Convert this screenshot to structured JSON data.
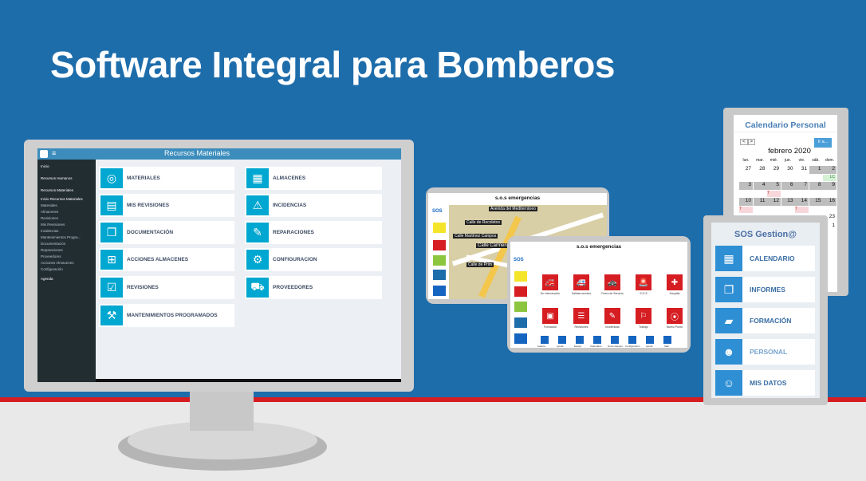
{
  "headline": "Software Integral para Bomberos",
  "monitor": {
    "app_title": "Recursos Materiales",
    "menu_icon": "≡",
    "sidebar": [
      "Inicio",
      "Recursos Humanos",
      "Recursos Materiales",
      "Inicio Recursos Materiales",
      "Materiales",
      "Almacenes",
      "Revisiones",
      "Mis Revisiones",
      "Incidencias",
      "Mantenimientos Progra...",
      "Documentación",
      "Reparaciones",
      "Proveedores",
      "Acciones Almacenes",
      "Configuración",
      "Agenda"
    ],
    "tiles": [
      {
        "label": "MATERIALES",
        "icon": "recycle-icon",
        "glyph": "◎"
      },
      {
        "label": "ALMACENES",
        "icon": "truck-icon",
        "glyph": "▦"
      },
      {
        "label": "MIS REVISIONES",
        "icon": "document-icon",
        "glyph": "▤"
      },
      {
        "label": "INCIDENCIAS",
        "icon": "warning-icon",
        "glyph": "⚠"
      },
      {
        "label": "DOCUMENTACIÓN",
        "icon": "files-icon",
        "glyph": "❐"
      },
      {
        "label": "REPARACIONES",
        "icon": "wrench-icon",
        "glyph": "✎"
      },
      {
        "label": "ACCIONES ALMACENES",
        "icon": "sitemap-icon",
        "glyph": "⊞"
      },
      {
        "label": "CONFIGURACION",
        "icon": "gear-icon",
        "glyph": "⚙"
      },
      {
        "label": "REVISIONES",
        "icon": "checklist-icon",
        "glyph": "☑"
      },
      {
        "label": "PROVEEDORES",
        "icon": "delivery-icon",
        "glyph": "⛟"
      },
      {
        "label": "MANTENIMIENTOS PROGRAMADOS",
        "icon": "car-wrench-icon",
        "glyph": "⚒"
      }
    ]
  },
  "tablet_map": {
    "title": "s.o.s emergencias",
    "sos_label": "SOS",
    "street_labels": [
      "Calle Carmen",
      "Calle de Recoletos",
      "Calle Martínez Campos",
      "Calle de Prim",
      "Avenida del Mediterráneo"
    ]
  },
  "tablet_sos": {
    "title": "s.o.s emergencias",
    "sos_label": "SOS",
    "buttons": [
      {
        "label": "En intervención",
        "glyph": "🚒"
      },
      {
        "label": "Salidas servicio",
        "glyph": "🚑"
      },
      {
        "label": "Fuera de Servicio",
        "glyph": "🚓"
      },
      {
        "label": "S.O.S",
        "glyph": "🚨"
      },
      {
        "label": "Hospital",
        "glyph": "✚"
      },
      {
        "label": "Formación",
        "glyph": "▣"
      },
      {
        "label": "Revisiones",
        "glyph": "☰"
      },
      {
        "label": "Incidencias",
        "glyph": "✎"
      },
      {
        "label": "Trabajo",
        "glyph": "⚐"
      },
      {
        "label": "Nuevo Punto",
        "glyph": "⦿"
      }
    ],
    "bottom": [
      "Galería",
      "Ayuda",
      "Equipo",
      "Calendario",
      "Nuevo Equipo",
      "Configuración",
      "Ayuda",
      "Salir"
    ]
  },
  "calendar": {
    "title": "Calendario Personal",
    "prev": "<",
    "next": ">",
    "go_btn": "Ir a...",
    "month": "febrero 2020",
    "weekdays": [
      "lun.",
      "mar.",
      "mié.",
      "jue.",
      "vie.",
      "sáb.",
      "dom."
    ],
    "rows": [
      [
        "27",
        "28",
        "29",
        "30",
        "31",
        "1",
        "2"
      ],
      [
        "",
        "",
        "",
        "",
        "",
        "",
        "LC"
      ],
      [
        "3",
        "4",
        "5",
        "6",
        "7",
        "8",
        "9"
      ],
      [
        "",
        "",
        "T",
        "",
        "",
        "",
        ""
      ],
      [
        "10",
        "11",
        "12",
        "13",
        "14",
        "15",
        "16"
      ],
      [
        "T",
        "",
        "",
        "",
        "T",
        "",
        ""
      ],
      [
        "",
        "",
        "",
        "",
        "",
        "",
        "23"
      ],
      [
        "",
        "",
        "",
        "",
        "",
        "",
        "1"
      ]
    ]
  },
  "gestion": {
    "title": "SOS Gestion@",
    "items": [
      {
        "label": "CALENDARIO",
        "glyph": "▦"
      },
      {
        "label": "INFORMES",
        "glyph": "❐"
      },
      {
        "label": "FORMACIÓN",
        "glyph": "▰"
      },
      {
        "label": "PERSONAL",
        "glyph": "☻"
      },
      {
        "label": "MIS DATOS",
        "glyph": "☺"
      }
    ]
  }
}
